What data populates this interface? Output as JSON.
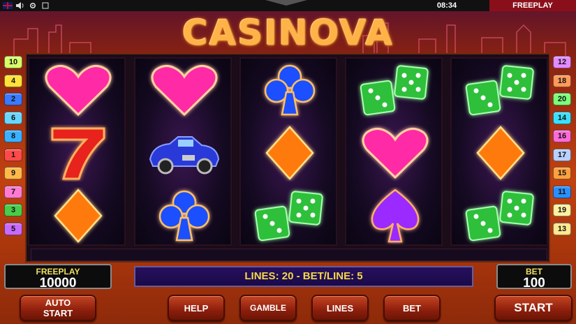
{
  "status_bar": {
    "clock": "08:34",
    "mode": "FREEPLAY",
    "icons": [
      "uk-flag-icon",
      "speaker-icon",
      "settings-icon",
      "fullscreen-icon"
    ]
  },
  "game": {
    "title": "CASINOVA",
    "left_line_numbers": [
      "10",
      "4",
      "2",
      "6",
      "8",
      "1",
      "9",
      "7",
      "3",
      "5"
    ],
    "right_line_numbers": [
      "12",
      "18",
      "20",
      "14",
      "16",
      "17",
      "15",
      "11",
      "19",
      "13"
    ],
    "reels": [
      [
        "heart",
        "seven",
        "diamond"
      ],
      [
        "heart",
        "car",
        "club"
      ],
      [
        "club",
        "diamond",
        "dice"
      ],
      [
        "dice",
        "heart",
        "spade"
      ],
      [
        "dice",
        "diamond",
        "dice"
      ]
    ]
  },
  "credit_panel": {
    "label": "FREEPLAY",
    "value": "10000"
  },
  "bet_panel": {
    "label": "BET",
    "value": "100"
  },
  "info": {
    "text": "LINES: 20  -  BET/LINE: 5"
  },
  "buttons": {
    "auto_start_line1": "AUTO",
    "auto_start_line2": "START",
    "help": "HELP",
    "gamble": "GAMBLE",
    "lines": "LINES",
    "bet": "BET",
    "start": "START"
  },
  "colors": {
    "heart": "#ff2aa6",
    "club": "#1d4fff",
    "diamond": "#ff7a10",
    "spade": "#9a2aff",
    "dice": "#2fbf3a",
    "seven": "#e8231a",
    "car": "#2a3ad8"
  }
}
